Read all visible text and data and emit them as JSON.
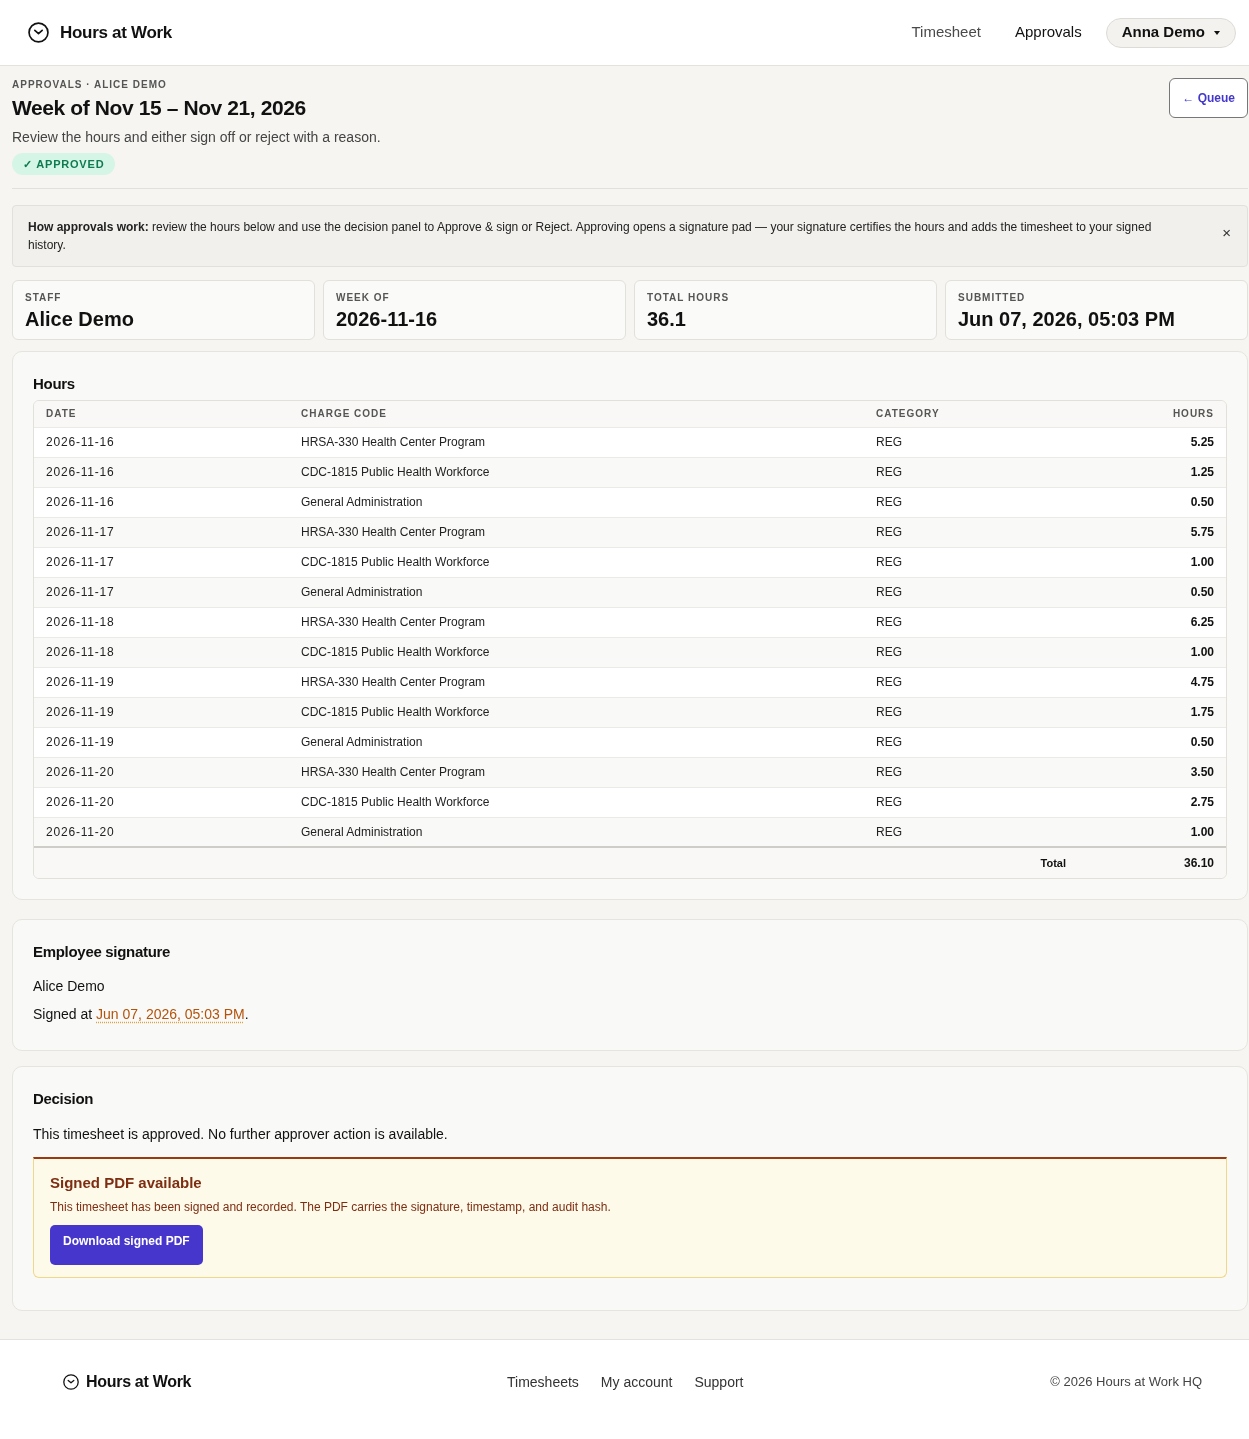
{
  "header": {
    "brand": "Hours at Work",
    "nav": [
      {
        "label": "Timesheet",
        "selected": false
      },
      {
        "label": "Approvals",
        "selected": true
      }
    ],
    "user_menu": "Anna Demo"
  },
  "page": {
    "breadcrumb": "APPROVALS · ALICE DEMO",
    "title": "Week of Nov 15 – Nov 21, 2026",
    "subtitle": "Review the hours and either sign off or reject with a reason.",
    "status": {
      "kind": "approved",
      "label": "✓ APPROVED"
    },
    "back_button": "← Queue"
  },
  "info_banner": {
    "text": "**How approvals work:** review the hours below and use the decision panel to Approve & sign or Reject. Approving opens a signature pad — your signature certifies the hours and adds the timesheet to your signed history.",
    "close": "×"
  },
  "stats": [
    {
      "label": "STAFF",
      "value": "Alice Demo"
    },
    {
      "label": "WEEK OF",
      "value": "2026-11-16"
    },
    {
      "label": "TOTAL HOURS",
      "value": "36.1"
    },
    {
      "label": "SUBMITTED",
      "value": "Jun 07, 2026, 05:03 PM"
    }
  ],
  "hours": {
    "title": "Hours",
    "columns": [
      "DATE",
      "CHARGE CODE",
      "CATEGORY",
      "HOURS"
    ],
    "rows": [
      [
        "2026-11-16",
        "HRSA-330 Health Center Program",
        "REG",
        "5.25"
      ],
      [
        "2026-11-16",
        "CDC-1815 Public Health Workforce",
        "REG",
        "1.25"
      ],
      [
        "2026-11-16",
        "General Administration",
        "REG",
        "0.50"
      ],
      [
        "2026-11-17",
        "HRSA-330 Health Center Program",
        "REG",
        "5.75"
      ],
      [
        "2026-11-17",
        "CDC-1815 Public Health Workforce",
        "REG",
        "1.00"
      ],
      [
        "2026-11-17",
        "General Administration",
        "REG",
        "0.50"
      ],
      [
        "2026-11-18",
        "HRSA-330 Health Center Program",
        "REG",
        "6.25"
      ],
      [
        "2026-11-18",
        "CDC-1815 Public Health Workforce",
        "REG",
        "1.00"
      ],
      [
        "2026-11-19",
        "HRSA-330 Health Center Program",
        "REG",
        "4.75"
      ],
      [
        "2026-11-19",
        "CDC-1815 Public Health Workforce",
        "REG",
        "1.75"
      ],
      [
        "2026-11-19",
        "General Administration",
        "REG",
        "0.50"
      ],
      [
        "2026-11-20",
        "HRSA-330 Health Center Program",
        "REG",
        "3.50"
      ],
      [
        "2026-11-20",
        "CDC-1815 Public Health Workforce",
        "REG",
        "2.75"
      ],
      [
        "2026-11-20",
        "General Administration",
        "REG",
        "1.00"
      ]
    ],
    "total_label": "Total",
    "total": "36.10"
  },
  "signature": {
    "title": "Employee signature",
    "name": "Alice Demo",
    "signed_prefix": "Signed at",
    "signed_at": "Jun 07, 2026, 05:03 PM",
    "signed_suffix": "."
  },
  "decision": {
    "title": "Decision",
    "message": "This timesheet is approved. No further approver action is available.",
    "signed_pdf": {
      "title": "Signed PDF available",
      "text": "This timesheet has been signed and recorded. The PDF carries the signature, timestamp, and audit hash.",
      "button": "Download signed PDF"
    }
  },
  "footer": {
    "brand": "Hours at Work",
    "links": [
      "Timesheets",
      "My account",
      "Support"
    ],
    "copyright": "© 2026 Hours at Work HQ"
  }
}
